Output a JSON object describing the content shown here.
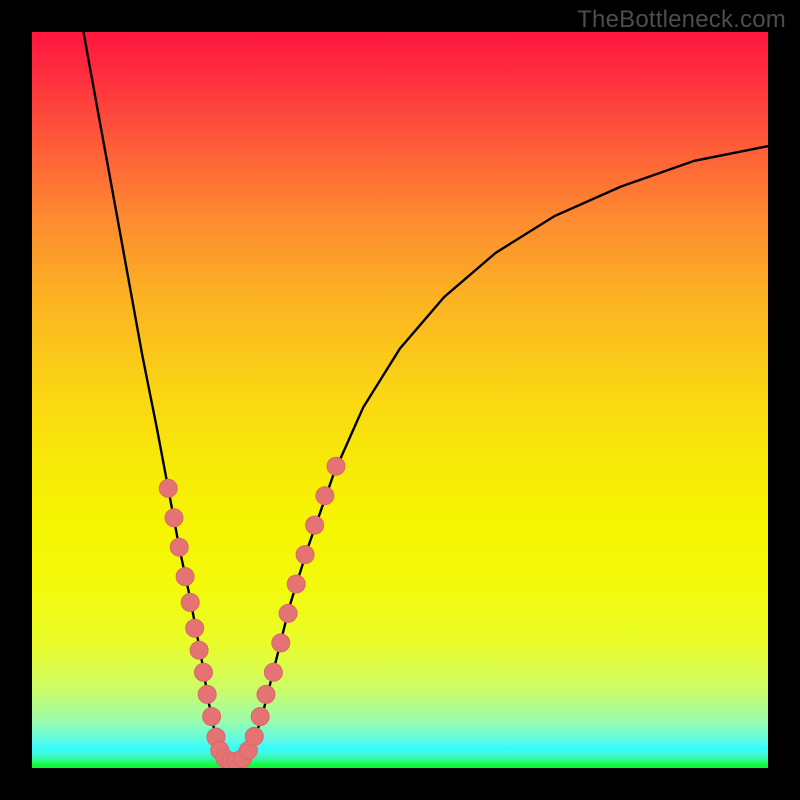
{
  "watermark": "TheBottleneck.com",
  "colors": {
    "frame": "#000000",
    "curve": "#000000",
    "dot_fill": "#e57373",
    "dot_stroke": "#d46a6a"
  },
  "chart_data": {
    "type": "line",
    "title": "",
    "xlabel": "",
    "ylabel": "",
    "xlim": [
      0,
      100
    ],
    "ylim": [
      0,
      100
    ],
    "note": "Values are approximate percentages of plot area; bottleneck-style V curve with minimum near x≈27.",
    "curve": [
      {
        "x": 7.0,
        "y": 100.0
      },
      {
        "x": 9.0,
        "y": 89.0
      },
      {
        "x": 11.0,
        "y": 78.0
      },
      {
        "x": 13.0,
        "y": 67.0
      },
      {
        "x": 15.0,
        "y": 56.0
      },
      {
        "x": 17.0,
        "y": 46.0
      },
      {
        "x": 18.5,
        "y": 38.0
      },
      {
        "x": 20.0,
        "y": 30.0
      },
      {
        "x": 21.5,
        "y": 23.0
      },
      {
        "x": 23.0,
        "y": 15.0
      },
      {
        "x": 24.0,
        "y": 9.0
      },
      {
        "x": 25.0,
        "y": 4.0
      },
      {
        "x": 26.0,
        "y": 1.3
      },
      {
        "x": 27.0,
        "y": 0.8
      },
      {
        "x": 28.0,
        "y": 0.8
      },
      {
        "x": 29.0,
        "y": 1.3
      },
      {
        "x": 30.0,
        "y": 3.0
      },
      {
        "x": 31.5,
        "y": 8.0
      },
      {
        "x": 33.0,
        "y": 14.0
      },
      {
        "x": 35.0,
        "y": 22.0
      },
      {
        "x": 37.5,
        "y": 30.0
      },
      {
        "x": 41.0,
        "y": 40.0
      },
      {
        "x": 45.0,
        "y": 49.0
      },
      {
        "x": 50.0,
        "y": 57.0
      },
      {
        "x": 56.0,
        "y": 64.0
      },
      {
        "x": 63.0,
        "y": 70.0
      },
      {
        "x": 71.0,
        "y": 75.0
      },
      {
        "x": 80.0,
        "y": 79.0
      },
      {
        "x": 90.0,
        "y": 82.5
      },
      {
        "x": 100.0,
        "y": 84.5
      }
    ],
    "series": [
      {
        "name": "left-branch-dots",
        "points": [
          {
            "x": 18.5,
            "y": 38.0
          },
          {
            "x": 19.3,
            "y": 34.0
          },
          {
            "x": 20.0,
            "y": 30.0
          },
          {
            "x": 20.8,
            "y": 26.0
          },
          {
            "x": 21.5,
            "y": 22.5
          },
          {
            "x": 22.1,
            "y": 19.0
          },
          {
            "x": 22.7,
            "y": 16.0
          },
          {
            "x": 23.3,
            "y": 13.0
          },
          {
            "x": 23.8,
            "y": 10.0
          },
          {
            "x": 24.4,
            "y": 7.0
          },
          {
            "x": 25.0,
            "y": 4.2
          }
        ]
      },
      {
        "name": "bottom-dots",
        "points": [
          {
            "x": 25.5,
            "y": 2.4
          },
          {
            "x": 26.2,
            "y": 1.3
          },
          {
            "x": 27.0,
            "y": 0.9
          },
          {
            "x": 27.8,
            "y": 0.9
          },
          {
            "x": 28.6,
            "y": 1.3
          },
          {
            "x": 29.4,
            "y": 2.4
          }
        ]
      },
      {
        "name": "right-branch-dots",
        "points": [
          {
            "x": 30.2,
            "y": 4.3
          },
          {
            "x": 31.0,
            "y": 7.0
          },
          {
            "x": 31.8,
            "y": 10.0
          },
          {
            "x": 32.8,
            "y": 13.0
          },
          {
            "x": 33.8,
            "y": 17.0
          },
          {
            "x": 34.8,
            "y": 21.0
          },
          {
            "x": 35.9,
            "y": 25.0
          },
          {
            "x": 37.1,
            "y": 29.0
          },
          {
            "x": 38.4,
            "y": 33.0
          },
          {
            "x": 39.8,
            "y": 37.0
          },
          {
            "x": 41.3,
            "y": 41.0
          }
        ]
      }
    ]
  }
}
